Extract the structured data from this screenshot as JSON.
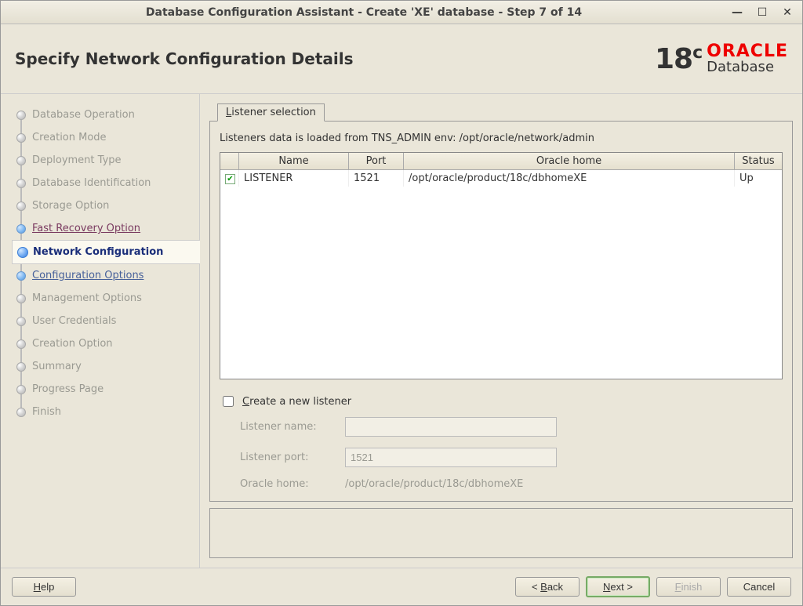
{
  "window": {
    "title": "Database Configuration Assistant - Create 'XE' database - Step 7 of 14"
  },
  "header": {
    "heading": "Specify Network Configuration Details",
    "logo_version": "18",
    "logo_version_suffix": "c",
    "logo_brand": "ORACLE",
    "logo_product": "Database"
  },
  "sidebar": {
    "steps": [
      {
        "label": "Database Operation",
        "state": "done"
      },
      {
        "label": "Creation Mode",
        "state": "done"
      },
      {
        "label": "Deployment Type",
        "state": "done"
      },
      {
        "label": "Database Identification",
        "state": "done"
      },
      {
        "label": "Storage Option",
        "state": "done"
      },
      {
        "label": "Fast Recovery Option",
        "state": "link"
      },
      {
        "label": "Network Configuration",
        "state": "current"
      },
      {
        "label": "Configuration Options",
        "state": "next-link"
      },
      {
        "label": "Management Options",
        "state": "future"
      },
      {
        "label": "User Credentials",
        "state": "future"
      },
      {
        "label": "Creation Option",
        "state": "future"
      },
      {
        "label": "Summary",
        "state": "future"
      },
      {
        "label": "Progress Page",
        "state": "future"
      },
      {
        "label": "Finish",
        "state": "future"
      }
    ]
  },
  "main": {
    "tab_label_pre": "L",
    "tab_label_rest": "istener selection",
    "info_line": "Listeners data is loaded from TNS_ADMIN env: /opt/oracle/network/admin",
    "columns": {
      "name": "Name",
      "port": "Port",
      "home": "Oracle home",
      "status": "Status"
    },
    "rows": [
      {
        "checked": true,
        "name": "LISTENER",
        "port": "1521",
        "home": "/opt/oracle/product/18c/dbhomeXE",
        "status": "Up"
      }
    ],
    "create_new_pre": "C",
    "create_new_rest": "reate a new listener",
    "create_new_checked": false,
    "form": {
      "listener_name_label": "Listener name:",
      "listener_name_value": "",
      "listener_port_label": "Listener port:",
      "listener_port_value": "1521",
      "oracle_home_label": "Oracle home:",
      "oracle_home_value": "/opt/oracle/product/18c/dbhomeXE"
    }
  },
  "footer": {
    "help_pre": "H",
    "help_rest": "elp",
    "back_pre": "< ",
    "back_ul": "B",
    "back_rest": "ack",
    "next_ul": "N",
    "next_rest": "ext >",
    "finish_ul": "F",
    "finish_rest": "inish",
    "cancel": "Cancel"
  }
}
